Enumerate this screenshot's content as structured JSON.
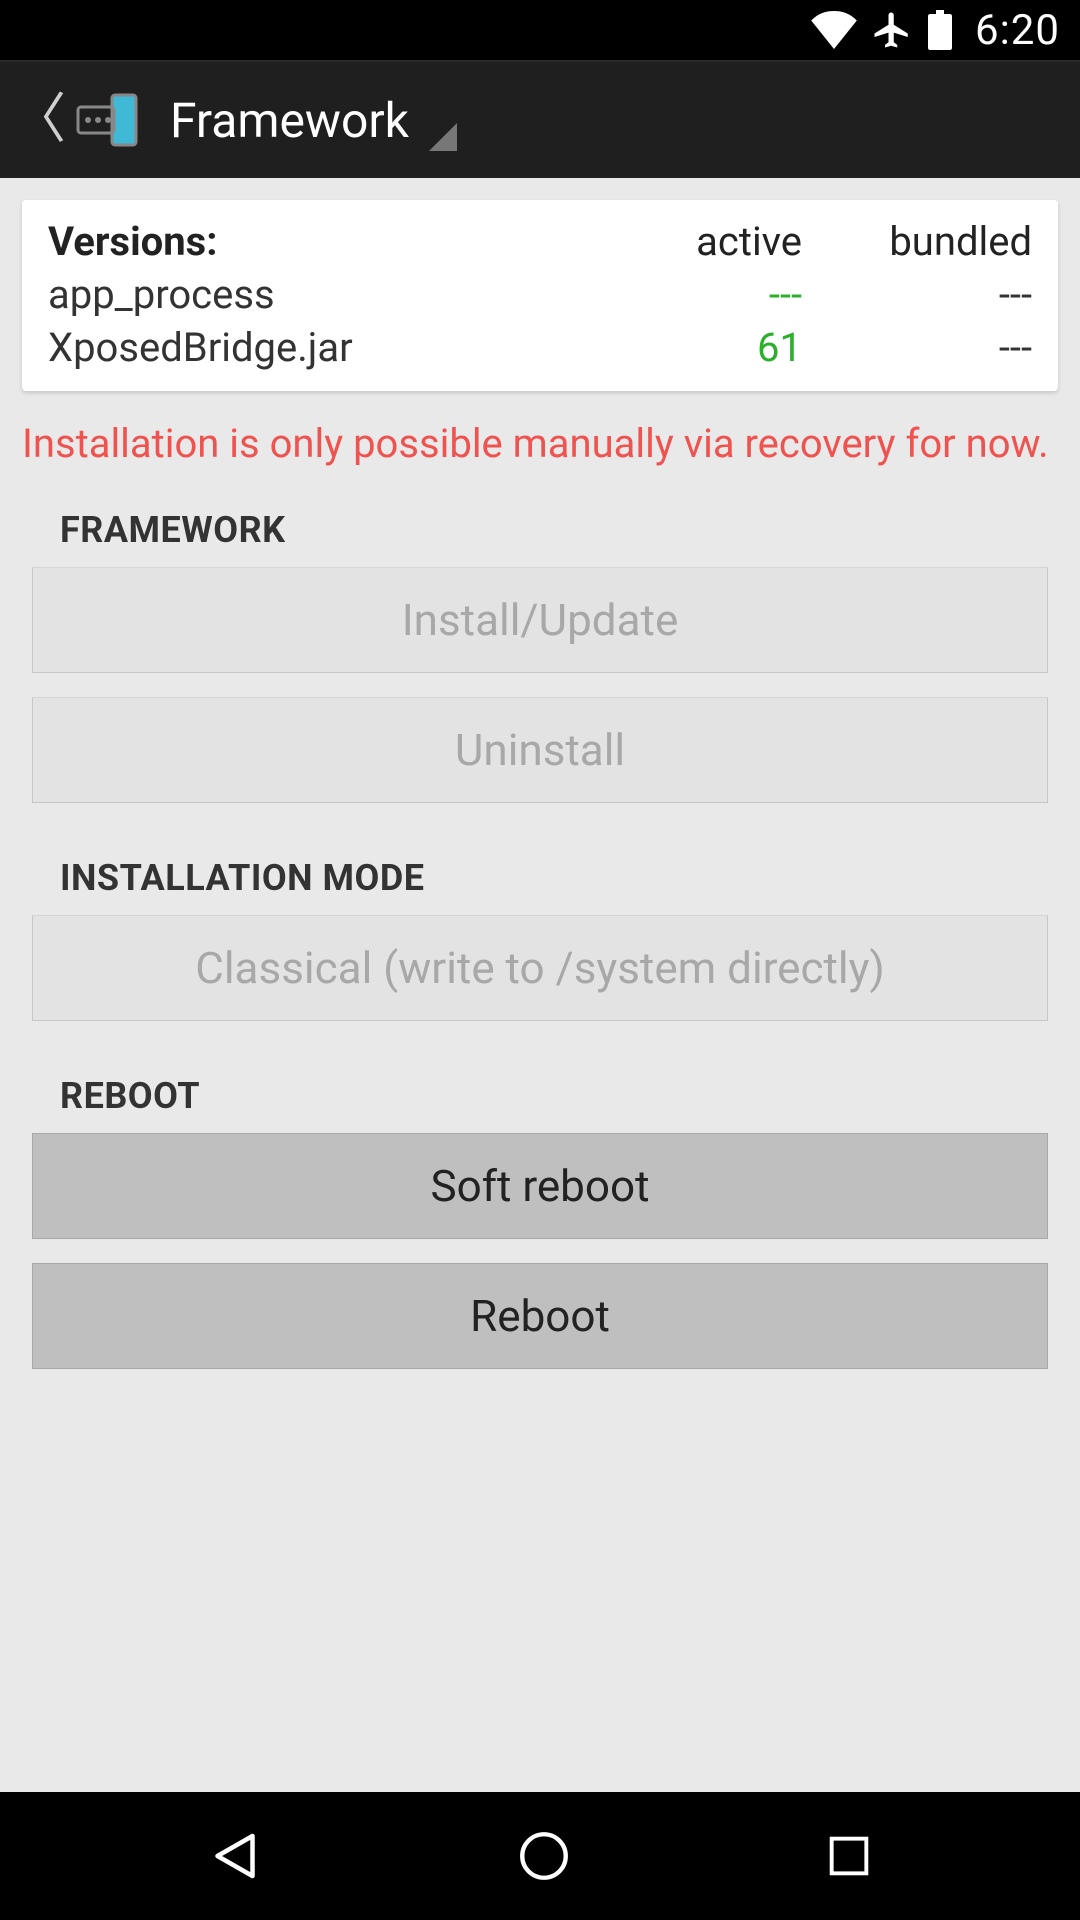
{
  "status_bar": {
    "time": "6:20"
  },
  "action_bar": {
    "title": "Framework"
  },
  "versions_card": {
    "title": "Versions:",
    "col_active": "active",
    "col_bundled": "bundled",
    "rows": [
      {
        "name": "app_process",
        "active": "---",
        "bundled": "---",
        "active_green": true
      },
      {
        "name": "XposedBridge.jar",
        "active": "61",
        "bundled": "---",
        "active_green": true
      }
    ]
  },
  "warning_text": "Installation is only possible manually via recovery for now.",
  "sections": {
    "framework": {
      "title": "FRAMEWORK",
      "install_label": "Install/Update",
      "uninstall_label": "Uninstall"
    },
    "installation_mode": {
      "title": "INSTALLATION MODE",
      "mode_label": "Classical (write to /system directly)"
    },
    "reboot": {
      "title": "REBOOT",
      "soft_reboot_label": "Soft reboot",
      "reboot_label": "Reboot"
    }
  }
}
